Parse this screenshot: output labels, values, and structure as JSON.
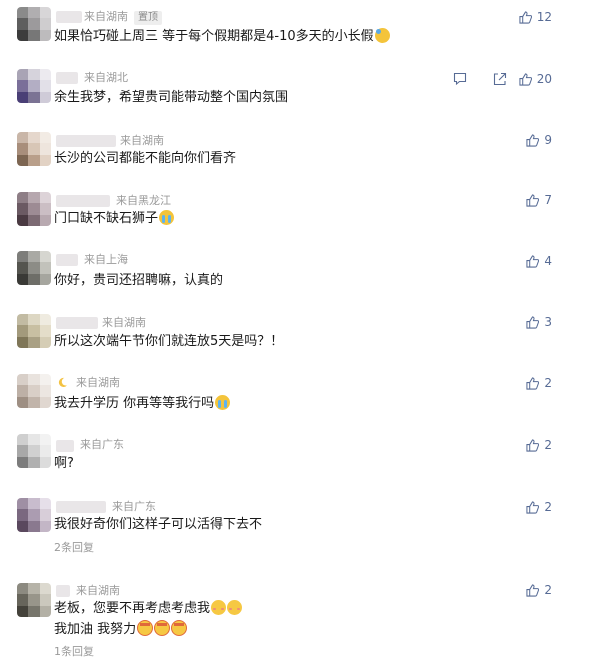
{
  "comments": [
    {
      "location": "来自湖南",
      "pinned_label": "置顶",
      "text": "如果恰巧碰上周三  等于每个假期都是4-10多天的小长假",
      "emojis": [
        "sweat"
      ],
      "likes": "12",
      "replies": ""
    },
    {
      "location": "来自湖北",
      "text": "余生我梦，希望贵司能带动整个国内氛围",
      "emojis": [],
      "likes": "20",
      "replies": ""
    },
    {
      "location": "来自湖南",
      "text": "长沙的公司都能不能向你们看齐",
      "emojis": [],
      "likes": "9",
      "replies": ""
    },
    {
      "location": "来自黑龙江",
      "text": "门口缺不缺石狮子",
      "emojis": [
        "cry"
      ],
      "likes": "7",
      "replies": ""
    },
    {
      "location": "来自上海",
      "text": "你好，贵司还招聘嘛，认真的",
      "emojis": [],
      "likes": "4",
      "replies": ""
    },
    {
      "location": "来自湖南",
      "text": "所以这次端午节你们就连放5天是吗？！",
      "emojis": [],
      "likes": "3",
      "replies": ""
    },
    {
      "location": "来自湖南",
      "text": "我去升学历  你再等等我行吗",
      "emojis": [
        "cry"
      ],
      "likes": "2",
      "replies": ""
    },
    {
      "location": "来自广东",
      "text": "啊?",
      "emojis": [],
      "likes": "2",
      "replies": ""
    },
    {
      "location": "来自广东",
      "text": "我很好奇你们这样子可以活得下去不",
      "emojis": [],
      "likes": "2",
      "replies": "2条回复"
    },
    {
      "location": "来自湖南",
      "text": "老板，您要不再考虑考虑我",
      "emojis": [
        "blush",
        "blush"
      ],
      "text2": "我加油  我努力",
      "emojis2": [
        "strong",
        "strong",
        "strong"
      ],
      "likes": "2",
      "replies": "1条回复"
    }
  ]
}
